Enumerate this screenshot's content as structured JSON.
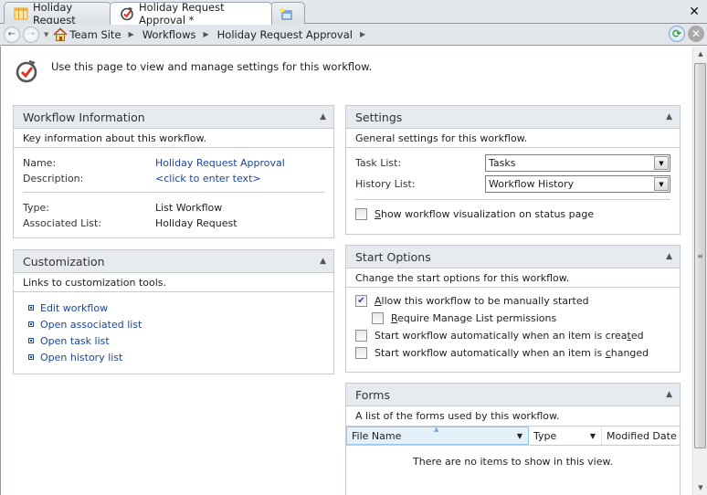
{
  "tabs": [
    {
      "label": "Holiday Request",
      "icon": "list-icon",
      "active": false
    },
    {
      "label": "Holiday Request Approval *",
      "icon": "workflow-icon",
      "active": true
    },
    {
      "label": "",
      "icon": "new-tab-icon",
      "active": false
    }
  ],
  "window": {
    "close_glyph": "✕"
  },
  "nav": {
    "back_glyph": "←",
    "forward_glyph": "→",
    "dropdown_glyph": "▼",
    "breadcrumb": [
      "Team Site",
      "Workflows",
      "Holiday Request Approval"
    ],
    "sep_glyph": "▶",
    "refresh_glyph": "⟳",
    "stop_glyph": "✕"
  },
  "intro": {
    "text": "Use this page to view and manage settings for this workflow."
  },
  "workflow_info": {
    "title": "Workflow Information",
    "collapse_glyph": "▲",
    "description": "Key information about this workflow.",
    "name_label": "Name:",
    "name_value": "Holiday Request Approval",
    "desc_label": "Description:",
    "desc_value": "<click to enter text>",
    "type_label": "Type:",
    "type_value": "List Workflow",
    "assoc_label": "Associated List:",
    "assoc_value": "Holiday Request"
  },
  "customization": {
    "title": "Customization",
    "collapse_glyph": "▲",
    "description": "Links to customization tools.",
    "links": [
      "Edit workflow",
      "Open associated list",
      "Open task list",
      "Open history list"
    ]
  },
  "settings": {
    "title": "Settings",
    "collapse_glyph": "▲",
    "description": "General settings for this workflow.",
    "task_list_label": "Task List:",
    "task_list_value": "Tasks",
    "history_list_label": "History List:",
    "history_list_value": "Workflow History",
    "dropdown_glyph": "▼",
    "show_viz_access": "S",
    "show_viz_rest": "how workflow visualization on status page",
    "show_viz_checked": false
  },
  "start_options": {
    "title": "Start Options",
    "collapse_glyph": "▲",
    "description": "Change the start options for this workflow.",
    "manual": {
      "access": "A",
      "rest": "llow this workflow to be manually started",
      "checked": true
    },
    "require_manage": {
      "access": "R",
      "rest": "equire Manage List permissions",
      "checked": false
    },
    "on_create": {
      "pre": "Start workflow automatically when an item is crea",
      "access": "t",
      "post": "ed",
      "checked": false
    },
    "on_change": {
      "pre": "Start workflow automatically when an item is ",
      "access": "c",
      "post": "hanged",
      "checked": false
    },
    "check_glyph": "✔"
  },
  "forms": {
    "title": "Forms",
    "collapse_glyph": "▲",
    "description": "A list of the forms used by this workflow.",
    "columns": [
      "File Name",
      "Type",
      "Modified Date"
    ],
    "sort_glyph": "▲",
    "dd_glyph": "▼",
    "empty_text": "There are no items to show in this view."
  },
  "scrollbar": {
    "up_glyph": "▲",
    "down_glyph": "▼",
    "grip_glyph": "≡"
  }
}
